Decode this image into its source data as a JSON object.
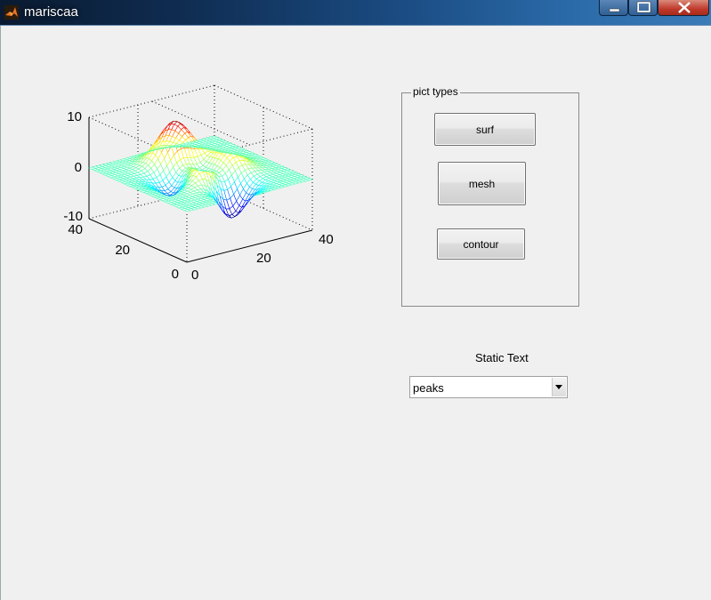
{
  "window": {
    "title": "mariscaa"
  },
  "axes": {
    "z_ticks": [
      "10",
      "0",
      "-10"
    ],
    "y_ticks": [
      "40",
      "20",
      "0"
    ],
    "x_ticks": [
      "0",
      "20",
      "40"
    ]
  },
  "panel": {
    "title": "pict types",
    "buttons": {
      "surf": "surf",
      "mesh": "mesh",
      "contour": "contour"
    }
  },
  "static_text": "Static Text",
  "popup": {
    "selected": "peaks"
  }
}
